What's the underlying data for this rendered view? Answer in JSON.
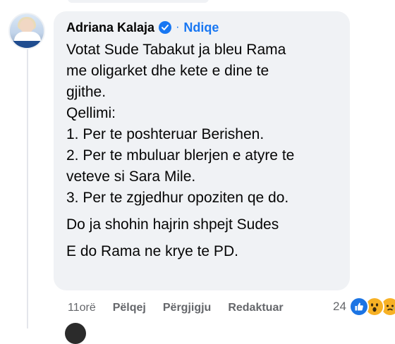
{
  "comment": {
    "author": "Adriana Kalaja",
    "follow_separator": "·",
    "follow_label": "Ndiqe",
    "body_lines": [
      "Votat Sude Tabakut ja bleu Rama",
      "me oligarket dhe kete e dine te",
      "gjithe.",
      "Qellimi:",
      "1. Per te poshteruar Berishen.",
      "2. Per te mbuluar blerjen e atyre te",
      "veteve si Sara Mile.",
      "3. Per te zgjedhur opoziten qe do.",
      "Do ja shohin hajrin shpejt Sudes",
      "E do Rama ne krye te PD."
    ]
  },
  "actions": {
    "time": "11orë",
    "like": "Pëlqej",
    "reply": "Përgjigju",
    "edit": "Redaktuar"
  },
  "reactions": {
    "count": "24",
    "icons": [
      "like-icon",
      "wow-icon",
      "sad-icon"
    ]
  },
  "colors": {
    "accent": "#1877f2",
    "bubble": "#f0f2f5",
    "meta_text": "#65676b"
  }
}
